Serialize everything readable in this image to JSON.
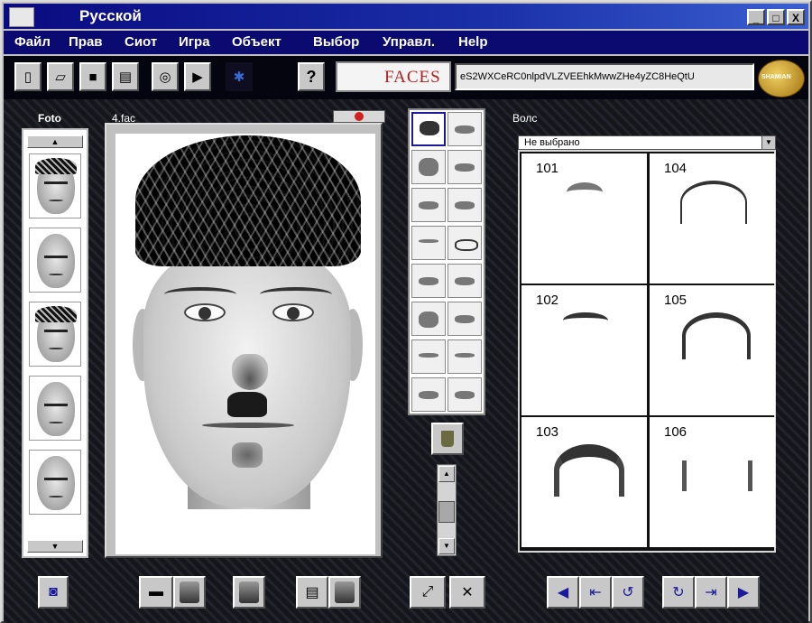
{
  "window": {
    "title": "Руccкой",
    "controls": [
      "_",
      "□",
      "X"
    ]
  },
  "menu": [
    "Файл",
    "Прав",
    "Сиот",
    "Игра",
    "Объект",
    "Выбор",
    "Управл.",
    "Help"
  ],
  "toolbar": {
    "buttons": [
      "new-icon",
      "open-icon",
      "save-icon",
      "print-icon",
      "spiral-icon",
      "play-icon",
      "gear-icon",
      "help-icon"
    ],
    "help_label": "?",
    "logo_text": "FACES",
    "code": "eS2WXCeRC0nlpdVLZVEEhkMwwZHe4yZC8HeQtU"
  },
  "badge_text": "SHAMIAN",
  "left_panel": {
    "title": "Foto"
  },
  "canvas": {
    "label": "4.fac"
  },
  "right_panel": {
    "title": "Волс",
    "select_value": "Не выбрано",
    "cells": [
      "101",
      "104",
      "102",
      "105",
      "103",
      "106"
    ]
  },
  "colors": {
    "menubar": "#0a0a70",
    "accent": "#1a1a9a",
    "danger": "#d02020"
  }
}
